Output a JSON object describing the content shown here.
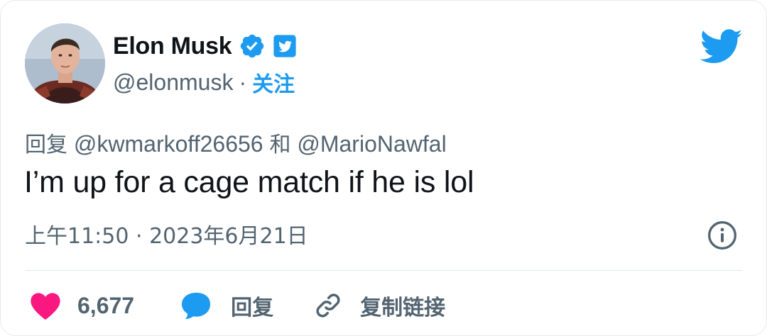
{
  "author": {
    "display_name": "Elon Musk",
    "handle": "@elonmusk",
    "separator": "·",
    "follow_label": "关注"
  },
  "reply_context": {
    "prefix": "回复",
    "user1": "@kwmarkoff26656",
    "conjunction": "和",
    "user2": "@MarioNawfal"
  },
  "tweet": {
    "text": "I’m up for a cage match if he is lol",
    "timestamp": "上午11:50 · 2023年6月21日"
  },
  "actions": {
    "like_count": "6,677",
    "reply_label": "回复",
    "copy_link_label": "复制链接"
  },
  "colors": {
    "twitter_blue": "#1d9bf0",
    "like_pink": "#f91880",
    "text_primary": "#0f1419",
    "text_secondary": "#536471"
  },
  "icons": [
    "verified-icon",
    "brand-badge-icon",
    "twitter-logo-icon",
    "info-icon",
    "heart-icon",
    "reply-bubble-icon",
    "link-icon"
  ]
}
